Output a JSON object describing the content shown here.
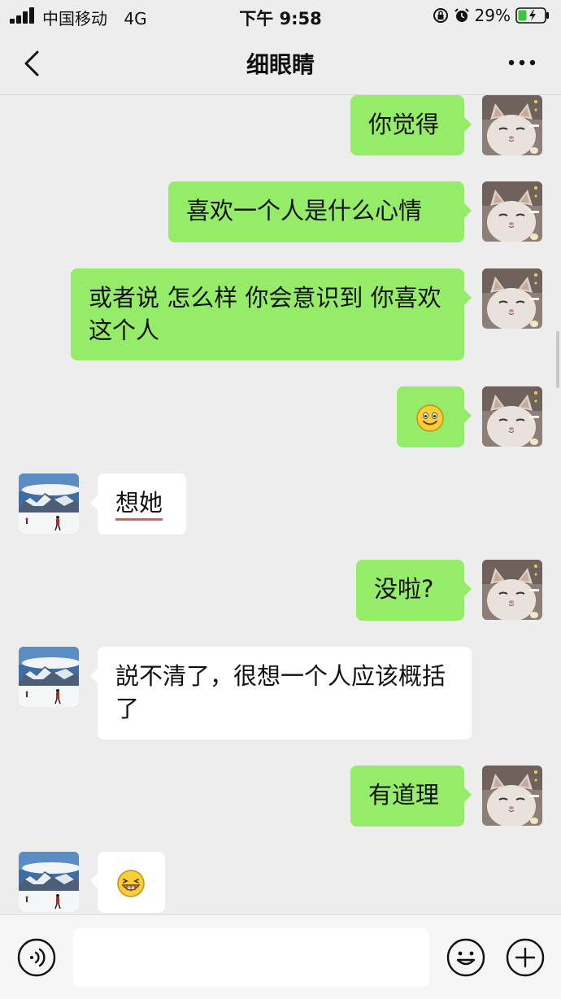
{
  "status_bar": {
    "carrier": "中国移动",
    "network": "4G",
    "time": "下午 9:58",
    "battery": "29%"
  },
  "header": {
    "title": "细眼睛"
  },
  "messages": [
    {
      "side": "me",
      "text": "你觉得"
    },
    {
      "side": "me",
      "text": "喜欢一个人是什么心情"
    },
    {
      "side": "me",
      "text": "或者说 怎么样 你会意识到 你喜欢这个人"
    },
    {
      "side": "me",
      "emoji": "smile-emoji"
    },
    {
      "side": "other",
      "text": "想她"
    },
    {
      "side": "me",
      "text": "没啦?"
    },
    {
      "side": "other",
      "text": "説不清了，很想一个人应该概括了"
    },
    {
      "side": "me",
      "text": "有道理"
    },
    {
      "side": "other",
      "emoji": "grin-emoji"
    }
  ],
  "input": {
    "value": "",
    "placeholder": ""
  },
  "colors": {
    "my_bubble": "#95ec69",
    "their_bubble": "#ffffff",
    "background": "#ededed"
  },
  "icons": [
    "signal-icon",
    "lock-icon",
    "alarm-icon",
    "battery-icon",
    "back-icon",
    "more-icon",
    "voice-icon",
    "emoji-icon",
    "plus-icon"
  ]
}
